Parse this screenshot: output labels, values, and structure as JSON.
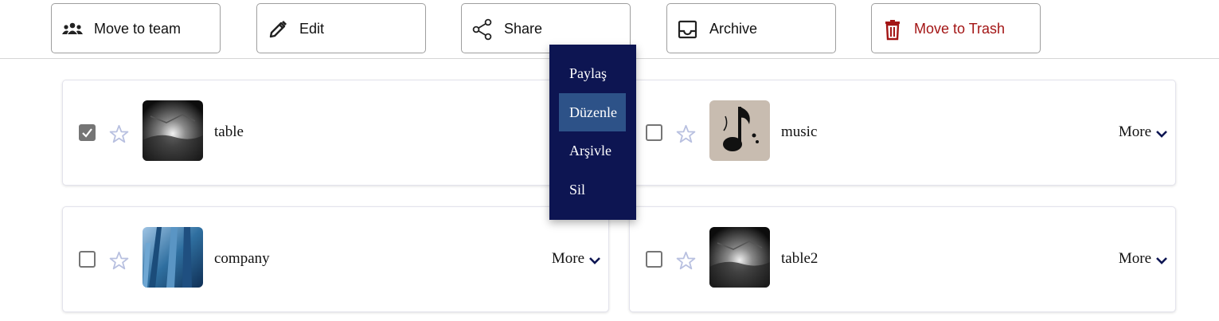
{
  "toolbar": {
    "move_to_team": "Move to team",
    "edit": "Edit",
    "share": "Share",
    "archive": "Archive",
    "move_to_trash": "Move to Trash"
  },
  "dropdown": {
    "items": [
      "Paylaş",
      "Düzenle",
      "Arşivle",
      "Sil"
    ],
    "active_index": 1
  },
  "cards": [
    {
      "name": "table",
      "checked": true,
      "starred": false,
      "more": ""
    },
    {
      "name": "music",
      "checked": false,
      "starred": false,
      "more": "More"
    },
    {
      "name": "company",
      "checked": false,
      "starred": false,
      "more": "More"
    },
    {
      "name": "table2",
      "checked": false,
      "starred": false,
      "more": "More"
    }
  ],
  "icons": {
    "move_to_team": "team-icon",
    "edit": "pencil-icon",
    "share": "share-icon",
    "archive": "inbox-icon",
    "move_to_trash": "trash-icon",
    "star": "star-outline-icon",
    "more": "chevron-down-icon"
  },
  "colors": {
    "danger": "#a31515",
    "menu_bg": "#0d1552",
    "menu_active": "#2d5288",
    "star": "#b8c0e0"
  }
}
